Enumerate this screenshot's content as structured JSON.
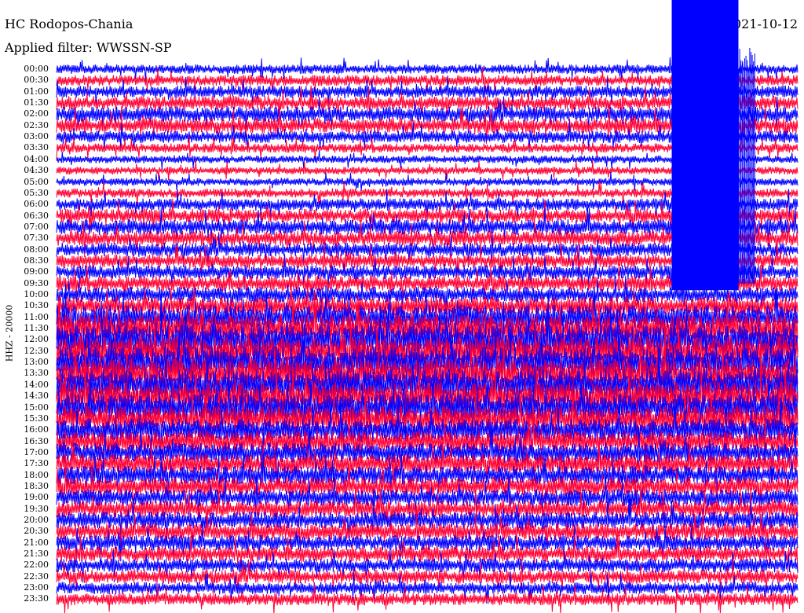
{
  "header": {
    "station": "HC Rodopos-Chania",
    "filter": "Applied filter: WWSSN-SP",
    "date": "2021-10-12"
  },
  "channel_label": "HHZ - 20000",
  "colors": {
    "trace_a": "#ff0033",
    "trace_b": "#0000ff",
    "background": "#ffffff"
  },
  "chart_data": {
    "type": "helicorder",
    "title": "HC Rodopos-Chania",
    "date": "2021-10-12",
    "filter": "WWSSN-SP",
    "channel": "HHZ - 20000",
    "row_labels": [
      "00:00",
      "00:30",
      "01:00",
      "01:30",
      "02:00",
      "02:30",
      "03:00",
      "03:30",
      "04:00",
      "04:30",
      "05:00",
      "05:30",
      "06:00",
      "06:30",
      "07:00",
      "07:30",
      "08:00",
      "08:30",
      "09:00",
      "09:30",
      "10:00",
      "10:30",
      "11:00",
      "11:30",
      "12:00",
      "12:30",
      "13:00",
      "13:30",
      "14:00",
      "14:30",
      "15:00",
      "15:30",
      "16:00",
      "16:30",
      "17:00",
      "17:30",
      "18:00",
      "18:30",
      "19:00",
      "19:30",
      "20:00",
      "20:30",
      "21:00",
      "21:30",
      "22:00",
      "22:30",
      "23:00",
      "23:30"
    ],
    "row_colors": [
      "blue",
      "red"
    ],
    "relative_amplitude": [
      0.6,
      0.7,
      0.8,
      0.9,
      1.0,
      1.0,
      0.8,
      0.6,
      0.5,
      0.5,
      0.5,
      0.6,
      0.8,
      0.9,
      1.0,
      1.0,
      0.9,
      0.9,
      0.9,
      1.0,
      1.0,
      1.2,
      1.6,
      1.9,
      2.0,
      2.0,
      2.0,
      2.0,
      2.0,
      1.9,
      1.8,
      1.7,
      1.5,
      1.4,
      1.3,
      1.3,
      1.2,
      1.2,
      1.1,
      1.1,
      1.1,
      1.1,
      1.0,
      1.0,
      0.9,
      0.9,
      0.8,
      0.8
    ],
    "saturated_interval": {
      "rows": [
        "00:00",
        "09:30"
      ],
      "time_fraction": [
        0.83,
        0.92
      ]
    },
    "x_range_minutes": [
      0,
      30
    ],
    "grid": false,
    "legend": "none"
  }
}
